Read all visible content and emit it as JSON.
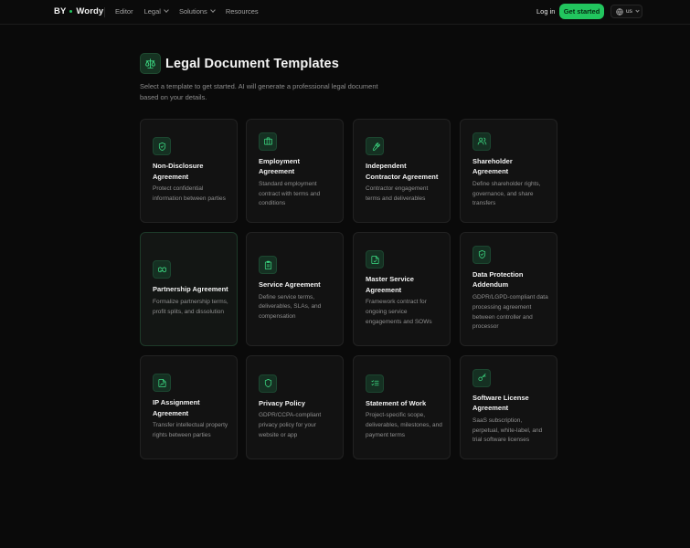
{
  "nav": {
    "brand_left": "BY",
    "brand_right": "Wordy",
    "links": [
      "Editor",
      "Legal",
      "Solutions",
      "Resources"
    ],
    "login": "Log in",
    "cta": "Get started",
    "locale": "us"
  },
  "header": {
    "title": "Legal Document Templates",
    "subtitle": "Select a template to get started. AI will generate a professional legal document based on your details."
  },
  "templates": [
    {
      "title": "Non-Disclosure Agreement",
      "description": "Protect confidential information between parties",
      "icon": "shield-icon"
    },
    {
      "title": "Employment Agreement",
      "description": "Standard employment contract with terms and conditions",
      "icon": "briefcase-icon"
    },
    {
      "title": "Independent Contractor Agreement",
      "description": "Contractor engagement terms and deliverables",
      "icon": "wrench-icon"
    },
    {
      "title": "Shareholder Agreement",
      "description": "Define shareholder rights, governance, and share transfers",
      "icon": "users-icon"
    },
    {
      "title": "Partnership Agreement",
      "description": "Formalize partnership terms, profit splits, and dissolution",
      "icon": "handshake-icon"
    },
    {
      "title": "Service Agreement",
      "description": "Define service terms, deliverables, SLAs, and compensation",
      "icon": "clipboard-icon"
    },
    {
      "title": "Master Service Agreement",
      "description": "Framework contract for ongoing service engagements and SOWs",
      "icon": "file-check-icon"
    },
    {
      "title": "Data Protection Addendum",
      "description": "GDPR/LGPD-compliant data processing agreement between controller and processor",
      "icon": "shield-check-icon"
    },
    {
      "title": "IP Assignment Agreement",
      "description": "Transfer intellectual property rights between parties",
      "icon": "file-signature-icon"
    },
    {
      "title": "Privacy Policy",
      "description": "GDPR/CCPA-compliant privacy policy for your website or app",
      "icon": "shield-icon"
    },
    {
      "title": "Statement of Work",
      "description": "Project-specific scope, deliverables, milestones, and payment terms",
      "icon": "list-check-icon"
    },
    {
      "title": "Software License Agreement",
      "description": "SaaS subscription, perpetual, white-label, and trial software licenses",
      "icon": "key-icon"
    }
  ],
  "colors": {
    "accent": "#22c55e",
    "icon_stroke": "#3ddc84",
    "background": "#0a0a0a",
    "card": "#121212"
  }
}
